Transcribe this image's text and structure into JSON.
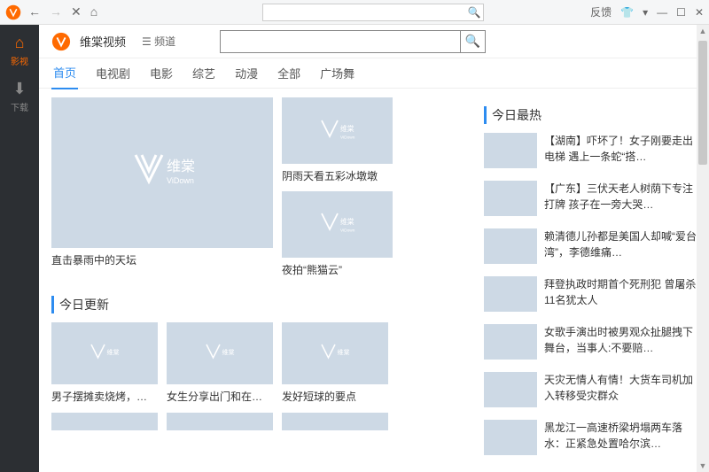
{
  "titlebar": {
    "feedback": "反馈"
  },
  "sidebar": {
    "items": [
      {
        "label": "影视"
      },
      {
        "label": "下载"
      }
    ]
  },
  "header": {
    "app_name": "维棠视频",
    "channel": "频道",
    "search_placeholder": ""
  },
  "tabs": [
    "首页",
    "电视剧",
    "电影",
    "综艺",
    "动漫",
    "全部",
    "广场舞"
  ],
  "hero": {
    "big_title": "直击暴雨中的天坛",
    "side": [
      {
        "title": "阴雨天看五彩冰墩墩"
      },
      {
        "title": "夜拍“熊猫云”"
      }
    ]
  },
  "sections": {
    "today_update": "今日更新",
    "today_hot": "今日最热"
  },
  "update_items": [
    {
      "title": "男子摆摊卖烧烤，还没卖…"
    },
    {
      "title": "女生分享出门和在家的区…"
    },
    {
      "title": "发好短球的要点"
    }
  ],
  "hot_items": [
    {
      "title": "【湖南】吓坏了！女子刚要走出电梯 遇上一条蛇“搭…"
    },
    {
      "title": "【广东】三伏天老人树荫下专注打牌 孩子在一旁大哭…"
    },
    {
      "title": "赖清德儿孙都是美国人却喊“爱台湾”，李德维痛…"
    },
    {
      "title": "拜登执政时期首个死刑犯 曾屠杀11名犹太人"
    },
    {
      "title": "女歌手演出时被男观众扯腿拽下舞台，当事人:不要赔…"
    },
    {
      "title": "天灾无情人有情！大货车司机加入转移受灾群众"
    },
    {
      "title": "黑龙江一高速桥梁坍塌两车落水：正紧急处置哈尔滨…"
    }
  ],
  "placeholder_text": {
    "brand": "维棠",
    "sub": "ViDown"
  }
}
